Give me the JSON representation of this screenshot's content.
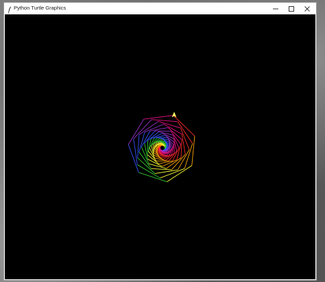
{
  "window": {
    "title": "Python Turtle Graphics",
    "icon": "feather-icon",
    "controls": [
      "minimize-icon",
      "maximize-icon",
      "close-icon"
    ]
  },
  "canvas": {
    "background": "#000000",
    "drawing": "spiral-of-heptagons",
    "colors": [
      "#ff2a2a",
      "#ffa500",
      "#ffff33",
      "#33cc33",
      "#3355ff",
      "#9933cc",
      "#ee1188"
    ],
    "cursor": "turtle-arrow-icon"
  }
}
